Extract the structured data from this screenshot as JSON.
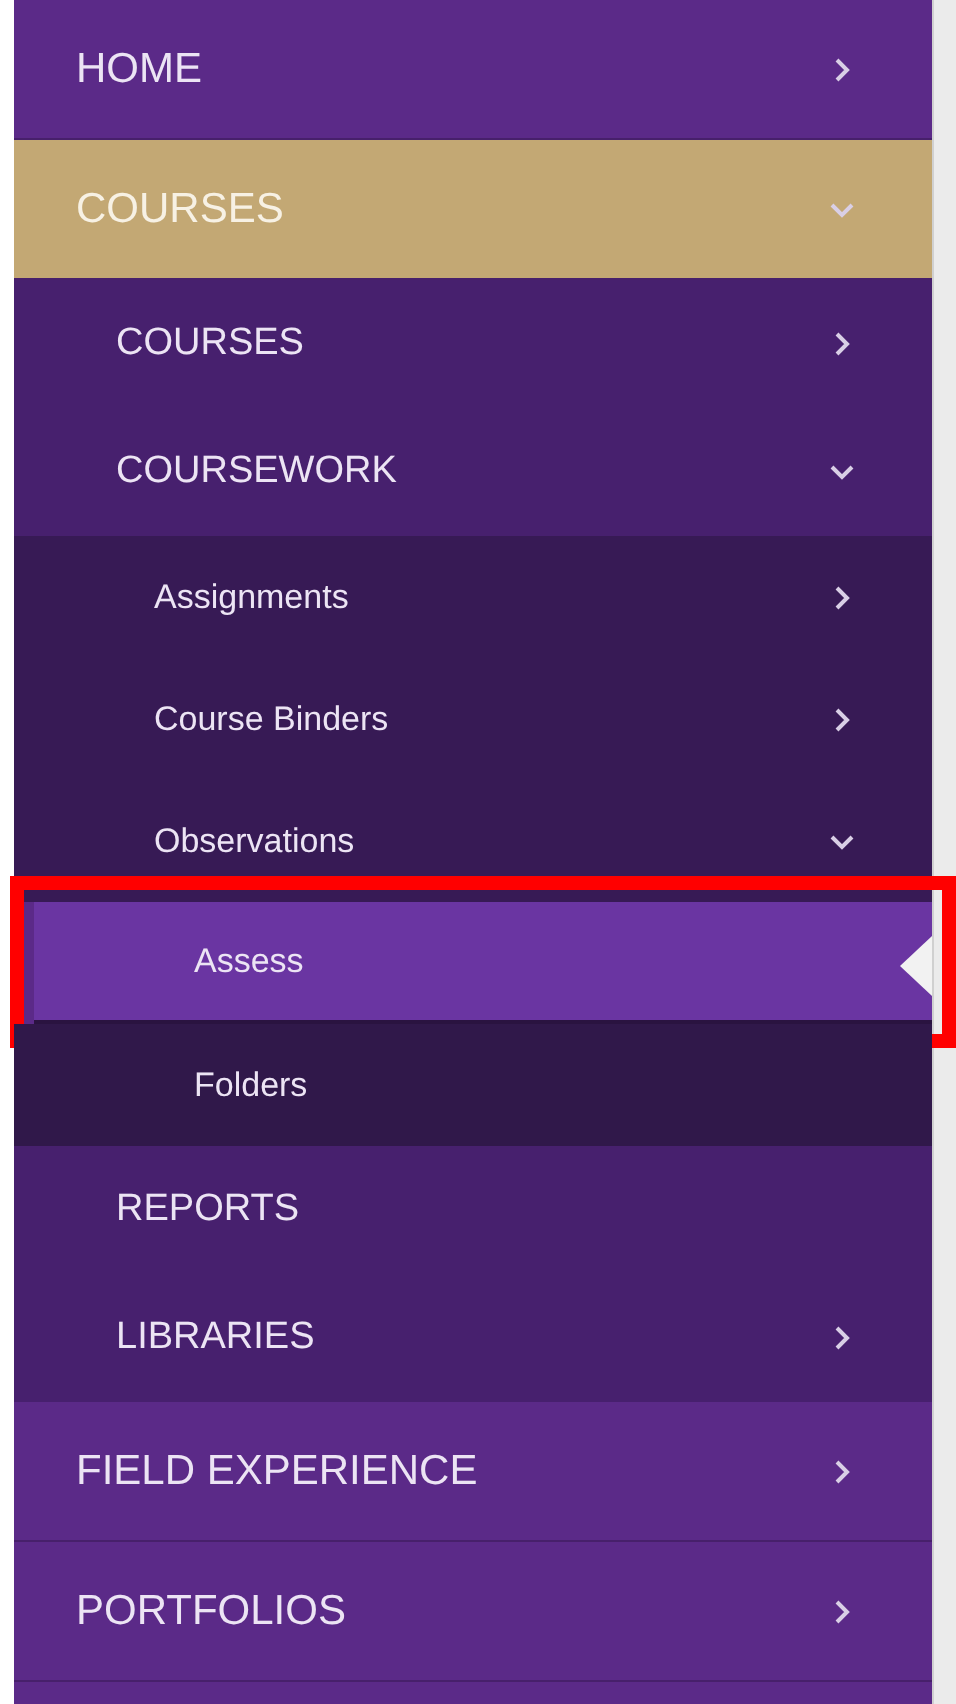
{
  "menu": [
    {
      "label": "HOME",
      "expanded": false,
      "selected": false
    },
    {
      "label": "COURSES",
      "expanded": true,
      "selected": false,
      "children": [
        {
          "label": "COURSES",
          "expanded": false,
          "selected": false
        },
        {
          "label": "COURSEWORK",
          "expanded": true,
          "selected": false,
          "children": [
            {
              "label": "Assignments",
              "expanded": false,
              "selected": false
            },
            {
              "label": "Course Binders",
              "expanded": false,
              "selected": false
            },
            {
              "label": "Observations",
              "expanded": true,
              "selected": false,
              "children": [
                {
                  "label": "Assess",
                  "selected": true,
                  "highlighted": true
                },
                {
                  "label": "Folders",
                  "selected": false
                }
              ]
            }
          ]
        },
        {
          "label": "REPORTS",
          "selected": false
        },
        {
          "label": "LIBRARIES",
          "expanded": false,
          "selected": false
        }
      ]
    },
    {
      "label": "FIELD EXPERIENCE",
      "expanded": false,
      "selected": false
    },
    {
      "label": "PORTFOLIOS",
      "expanded": false,
      "selected": false
    }
  ]
}
